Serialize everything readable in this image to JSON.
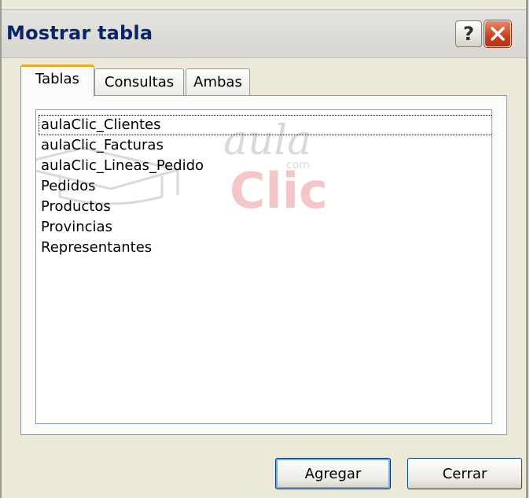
{
  "window": {
    "title": "Mostrar tabla",
    "help_label": "?"
  },
  "tabs": [
    {
      "label": "Tablas",
      "active": true
    },
    {
      "label": "Consultas",
      "active": false
    },
    {
      "label": "Ambas",
      "active": false
    }
  ],
  "list": {
    "items": [
      "aulaClic_Clientes",
      "aulaClic_Facturas",
      "aulaClic_Lineas_Pedido",
      "Pedidos",
      "Productos",
      "Provincias",
      "Representantes"
    ],
    "focused_index": 0
  },
  "watermark": {
    "line1": "aula",
    "line2": "Clic",
    "suffix": "com",
    "color_primary": "#f3c7c7",
    "color_secondary": "#d9d9d9"
  },
  "buttons": {
    "add": "Agregar",
    "close": "Cerrar"
  },
  "colors": {
    "title_text": "#0a246a",
    "active_tab_accent": "#f5a621",
    "close_button": "#c9401c"
  }
}
